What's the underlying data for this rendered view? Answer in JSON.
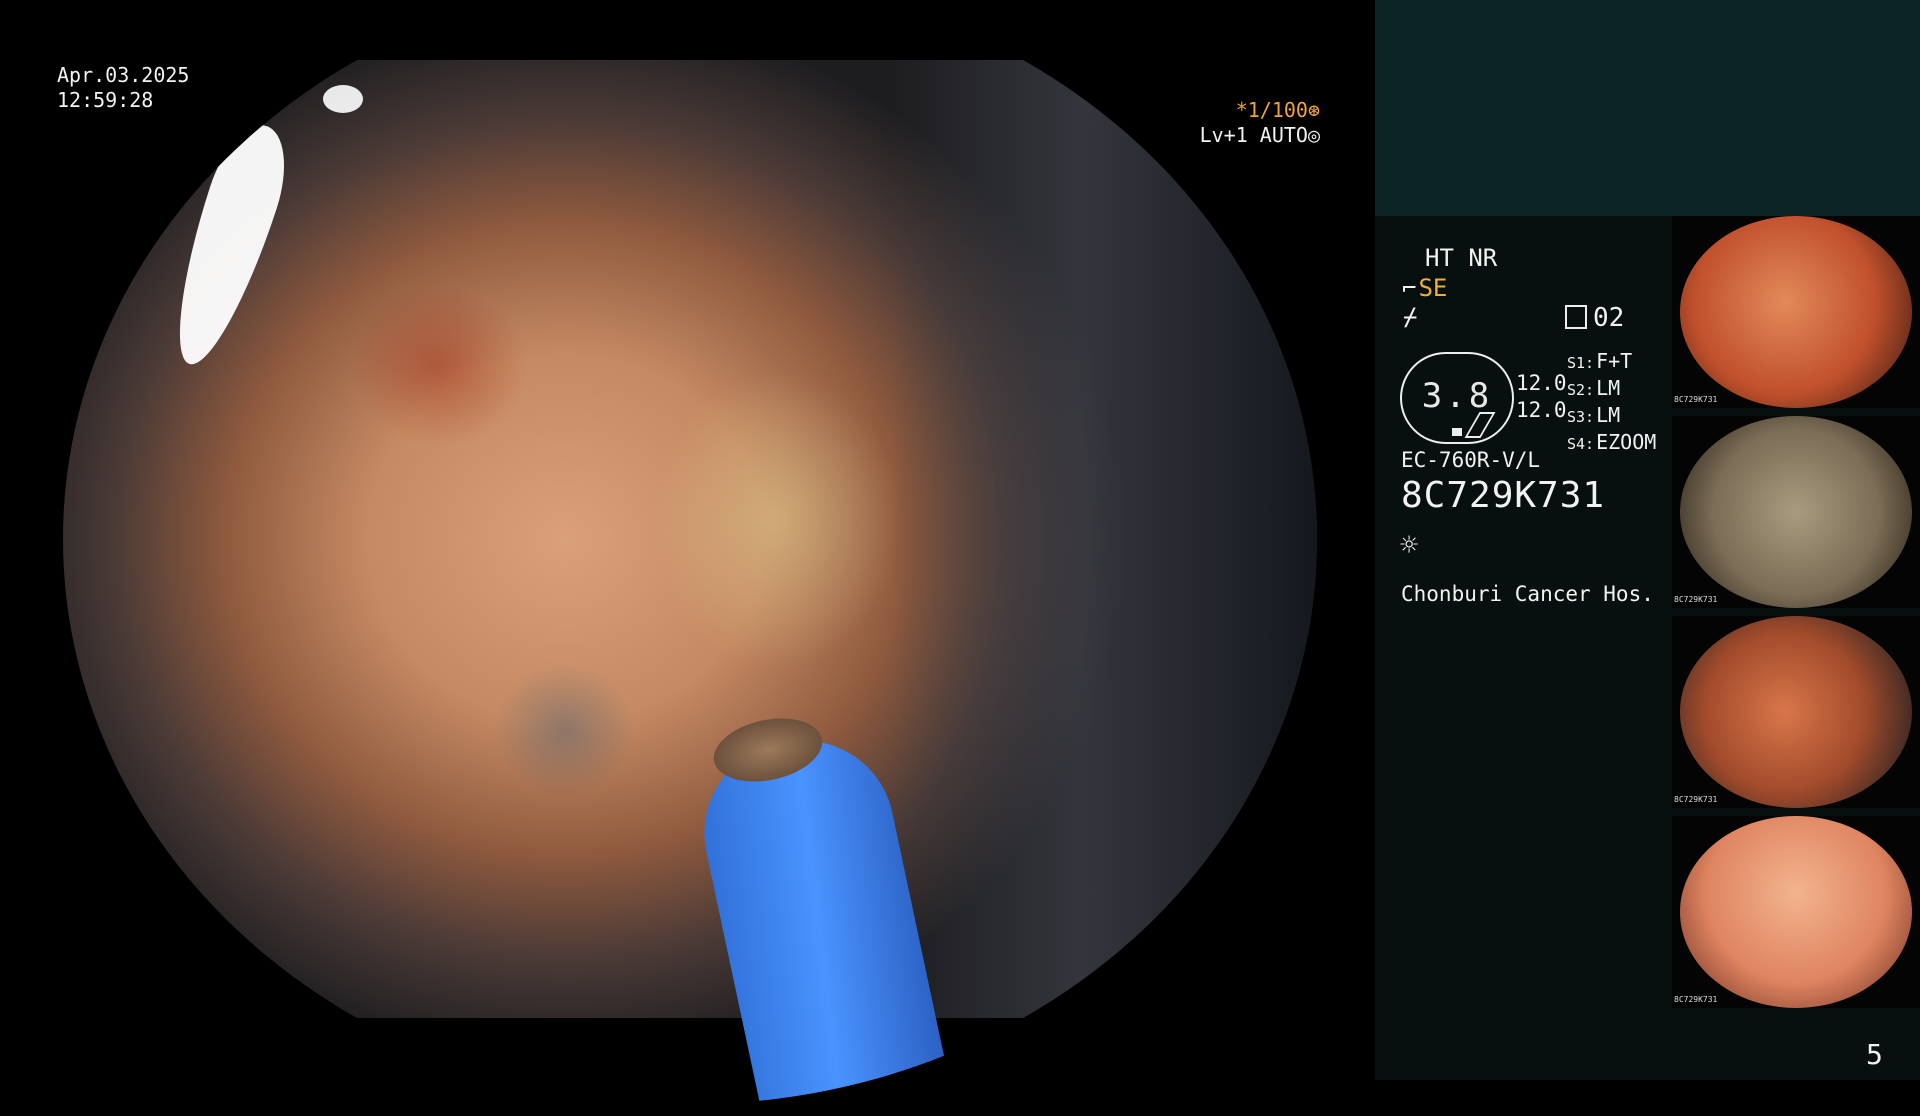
{
  "overlay": {
    "date": "Apr.03.2025",
    "time": "12:59:28",
    "shutter": "*1/100",
    "shutter_icon": "aperture-icon",
    "level": "Lv+1 AUTO",
    "level_icon": "iris-icon"
  },
  "panel": {
    "modes": "HT NR",
    "se_label": "SE",
    "filter_glyph": "⌿",
    "channel": "02",
    "dial_value": "3.8",
    "values": [
      "12.0",
      "12.0"
    ],
    "scope_slots": [
      {
        "key": "S1:",
        "value": "F+T"
      },
      {
        "key": "S2:",
        "value": "LM"
      },
      {
        "key": "S3:",
        "value": "LM"
      },
      {
        "key": "S4:",
        "value": "EZOOM"
      }
    ],
    "model": "EC-760R-V/L",
    "serial": "8C729K731",
    "light_icon": "sun-icon",
    "hospital": "Chonburi Cancer Hos."
  },
  "thumbnails": [
    {
      "caption": "8C729K731"
    },
    {
      "caption": "8C729K731"
    },
    {
      "caption": "8C729K731"
    },
    {
      "caption": "8C729K731"
    }
  ],
  "page_number": "5",
  "colors": {
    "accent_orange": "#f0a23a",
    "accent_yellow": "#f0b030",
    "panel_top": "#0b2426",
    "panel_bg": "#07100f"
  }
}
